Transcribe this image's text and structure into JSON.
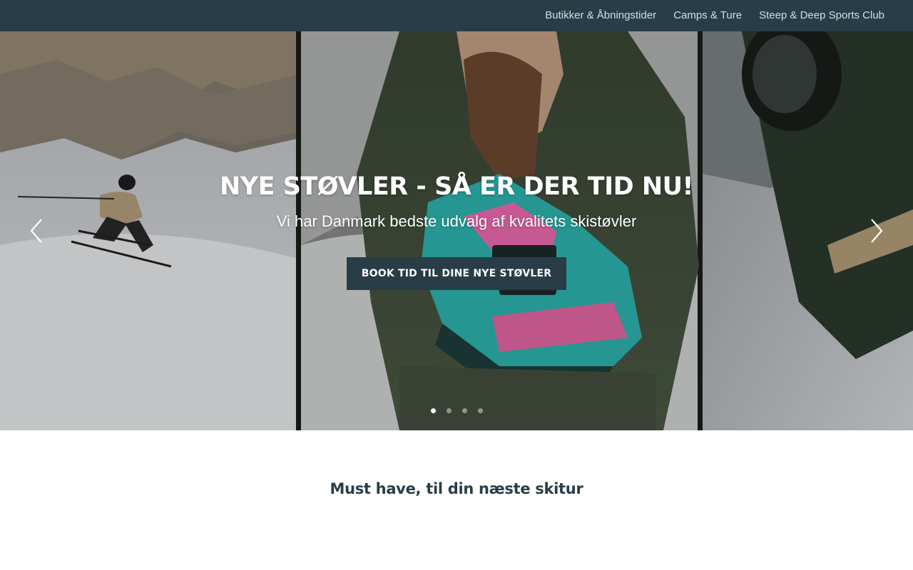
{
  "nav": {
    "items": [
      {
        "label": "Butikker & Åbningstider"
      },
      {
        "label": "Camps & Ture"
      },
      {
        "label": "Steep & Deep Sports Club"
      }
    ]
  },
  "hero": {
    "title": "NYE STØVLER - SÅ ER DER TID NU!",
    "subtitle": "Vi har Danmark bedste udvalg af kvalitets skistøvler",
    "cta_label": "BOOK TID TIL DINE NYE STØVLER",
    "prev_icon": "chevron-left-icon",
    "next_icon": "chevron-right-icon",
    "slide_count": 4,
    "active_slide": 1
  },
  "section": {
    "heading": "Must have, til din næste skitur"
  },
  "colors": {
    "navbar_bg": "#283d47",
    "nav_text": "#d6dfe3",
    "cta_bg": "#283d47",
    "heading_text": "#283d47"
  }
}
